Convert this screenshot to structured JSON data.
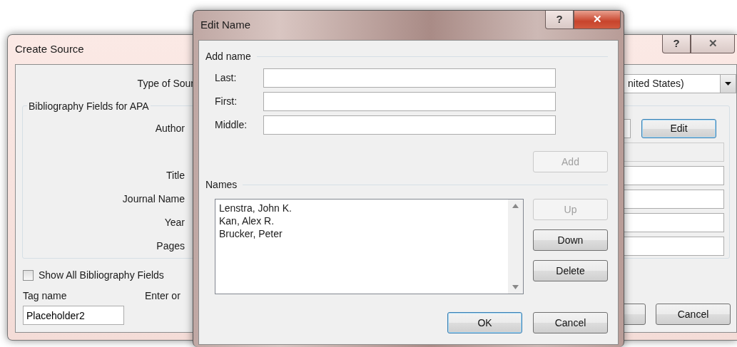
{
  "create_source": {
    "title": "Create Source",
    "help_button": "?",
    "close_button": "✕",
    "type_of_source": {
      "label": "Type of Sour",
      "value": "nited States)"
    },
    "group_title": "Bibliography Fields for APA",
    "fields": [
      {
        "kind": "author",
        "label": "Author",
        "button": "Edit",
        "disabled": false
      },
      {
        "kind": "text",
        "disabled": true
      },
      {
        "kind": "text",
        "label": "Title",
        "disabled": false
      },
      {
        "kind": "text",
        "label": "Journal Name",
        "disabled": false
      },
      {
        "kind": "text",
        "label": "Year",
        "disabled": false
      },
      {
        "kind": "text",
        "label": "Pages",
        "disabled": false
      }
    ],
    "show_all": {
      "label": "Show All Bibliography Fields",
      "checked": false
    },
    "tag_name": {
      "label": "Tag name",
      "value": "Placeholder2"
    },
    "hint": "Enter or",
    "cancel_button": "Cancel"
  },
  "edit_name": {
    "title": "Edit Name",
    "help_button": "?",
    "close_button": "✕",
    "add_name_title": "Add name",
    "fields": [
      {
        "label": "Last:"
      },
      {
        "label": "First:"
      },
      {
        "label": "Middle:"
      }
    ],
    "add_button": {
      "label": "Add",
      "disabled": true
    },
    "names_title": "Names",
    "names": [
      {
        "text": "Lenstra, John K."
      },
      {
        "text": "Kan, Alex R."
      },
      {
        "text": "Brucker, Peter"
      }
    ],
    "side_buttons": [
      {
        "label": "Up",
        "disabled": true
      },
      {
        "label": "Down",
        "disabled": false
      },
      {
        "label": "Delete",
        "disabled": false
      }
    ],
    "footer_buttons": [
      {
        "label": "OK",
        "default": true
      },
      {
        "label": "Cancel",
        "default": false
      }
    ]
  }
}
